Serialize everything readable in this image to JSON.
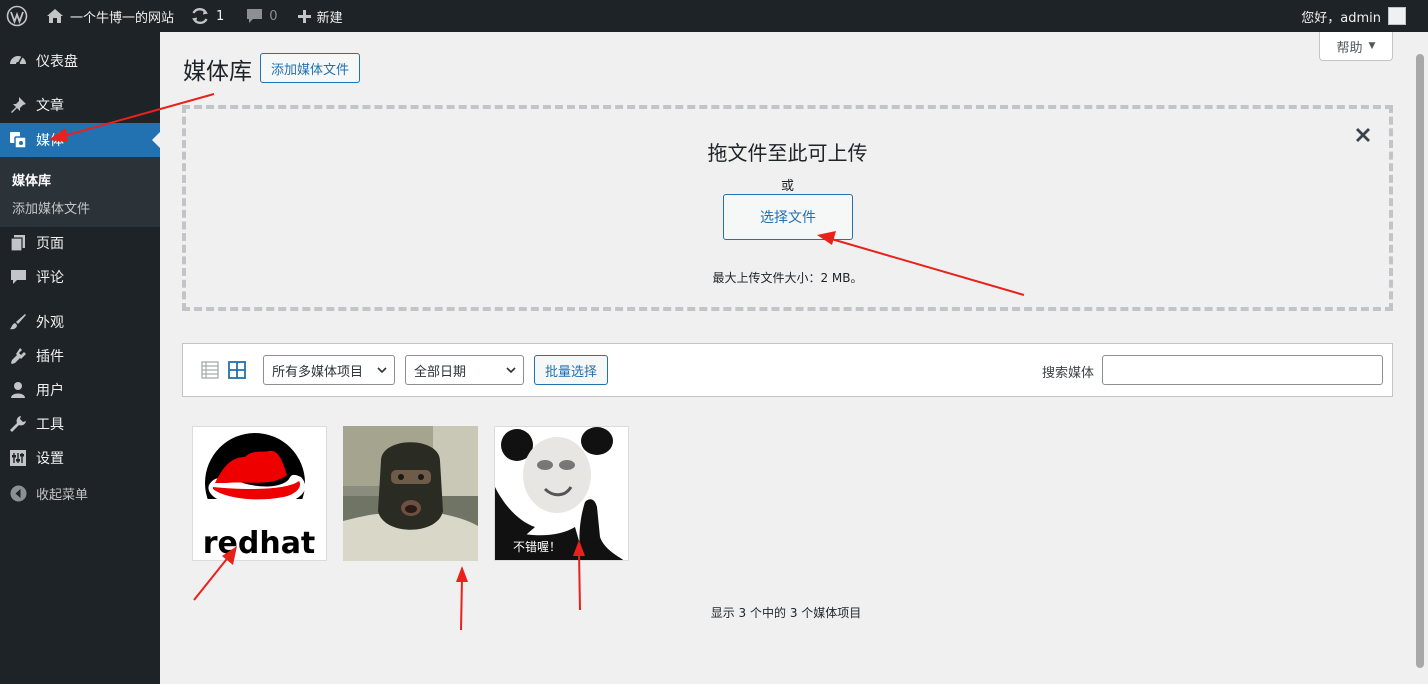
{
  "admin_bar": {
    "site_name": "一个牛博一的网站",
    "updates_count": "1",
    "comments_count": "0",
    "new_label": "新建",
    "greeting": "您好，admin"
  },
  "sidebar": {
    "items": [
      {
        "label": "仪表盘",
        "icon": "dashboard-icon"
      },
      {
        "label": "文章",
        "icon": "pin-icon"
      },
      {
        "label": "媒体",
        "icon": "media-icon"
      },
      {
        "label": "页面",
        "icon": "pages-icon"
      },
      {
        "label": "评论",
        "icon": "comment-icon"
      },
      {
        "label": "外观",
        "icon": "brush-icon"
      },
      {
        "label": "插件",
        "icon": "plug-icon"
      },
      {
        "label": "用户",
        "icon": "user-icon"
      },
      {
        "label": "工具",
        "icon": "wrench-icon"
      },
      {
        "label": "设置",
        "icon": "settings-icon"
      },
      {
        "label": "收起菜单",
        "icon": "collapse-icon"
      }
    ],
    "submenu": [
      "媒体库",
      "添加媒体文件"
    ]
  },
  "help_label": "帮助",
  "page_title": "媒体库",
  "add_new_label": "添加媒体文件",
  "uploader": {
    "title": "拖文件至此可上传",
    "or": "或",
    "select_button": "选择文件",
    "max_size": "最大上传文件大小：2 MB。"
  },
  "filters": {
    "type_selected": "所有多媒体项目",
    "date_selected": "全部日期",
    "bulk_select_label": "批量选择",
    "search_label": "搜索媒体",
    "search_value": ""
  },
  "media_items": [
    {
      "name": "redhat-logo",
      "caption": "redhat"
    },
    {
      "name": "masked-soldier",
      "caption": ""
    },
    {
      "name": "panda-meme",
      "caption": "不错喔！"
    }
  ],
  "media_count": "显示 3 个中的 3 个媒体项目",
  "colors": {
    "admin_dark": "#1d2327",
    "accent": "#2271b1",
    "annotation_red": "#e8221b",
    "redhat_red": "#ee0000"
  }
}
